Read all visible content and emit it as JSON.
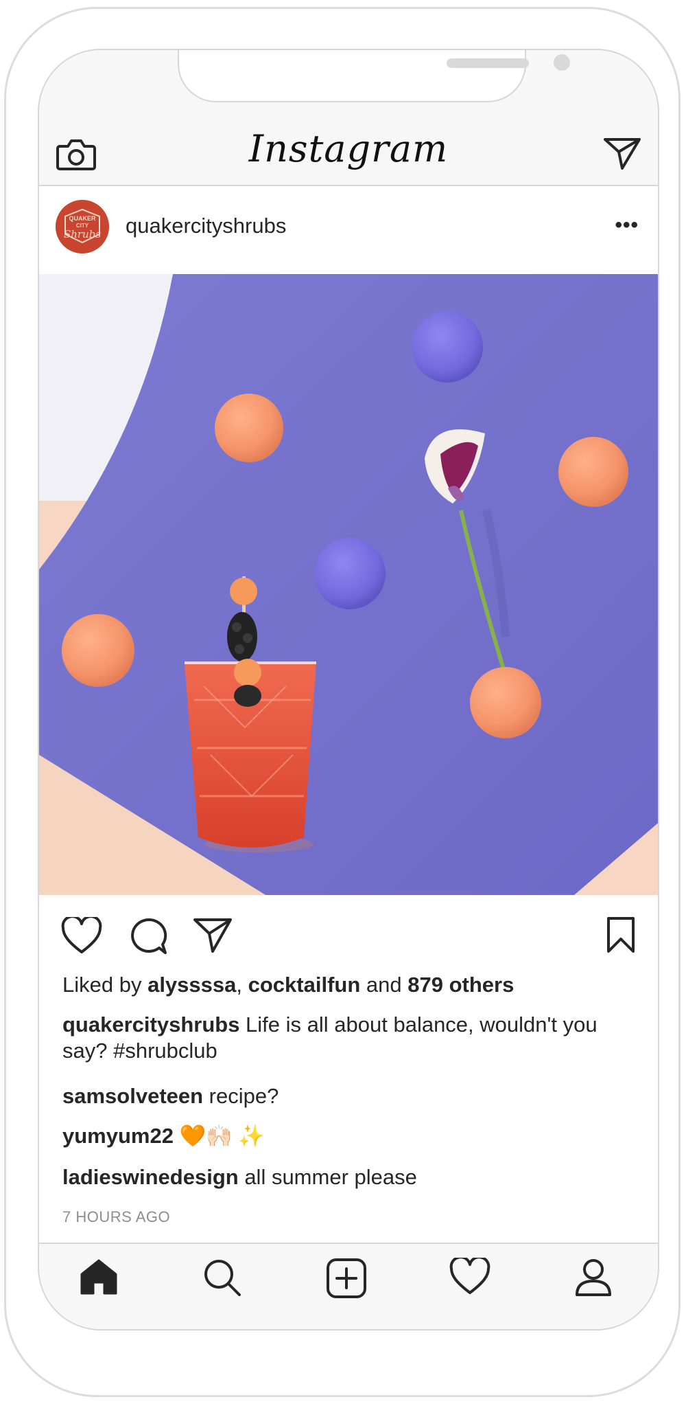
{
  "app": {
    "logo_text": "Instagram"
  },
  "topbar": {
    "left_icon": "camera-icon",
    "right_icon": "paper-plane-icon"
  },
  "post": {
    "username": "quakercityshrubs",
    "avatar_text": [
      "QUAKER",
      "CITY",
      "Shrubs"
    ],
    "more_label": "•••",
    "likes": {
      "prefix": "Liked by ",
      "user1": "alyssssa",
      "sep": ", ",
      "user2": "cocktailfun",
      "and": " and ",
      "others": "879 others"
    },
    "caption": {
      "user": "quakercityshrubs",
      "text": " Life is all about balance, wouldn't you say? #shrubclub"
    },
    "comments": [
      {
        "user": "samsolveteen",
        "text": " recipe?"
      },
      {
        "user": "yumyum22",
        "text": " 🧡🙌🏻 ✨"
      },
      {
        "user": "ladieswinedesign",
        "text": " all summer please"
      }
    ],
    "time_ago": "7 HOURS AGO"
  },
  "actions": {
    "icons": [
      "heart-icon",
      "comment-icon",
      "share-icon",
      "bookmark-icon"
    ]
  },
  "bottom_nav": {
    "items": [
      "home-icon",
      "search-icon",
      "new-post-icon",
      "activity-heart-icon",
      "profile-icon"
    ]
  },
  "colors": {
    "backdrop_purple": "#7b78cf",
    "sphere_orange": "#f59a70",
    "sphere_purple": "#7a71e3",
    "cocktail_red": "#e8503a",
    "floor_peach": "#f7d7c4",
    "avatar_red": "#c9452f"
  }
}
